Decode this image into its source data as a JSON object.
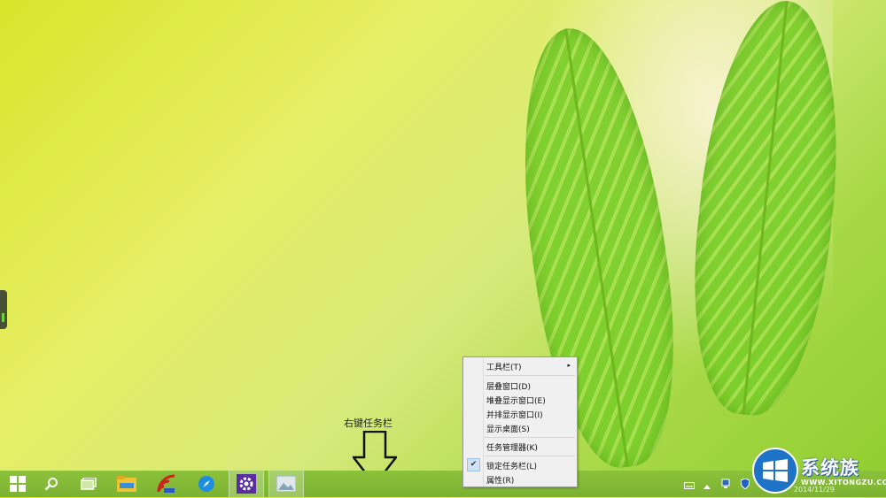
{
  "annotation": {
    "label": "右键任务栏"
  },
  "context_menu": {
    "items": [
      {
        "label": "工具栏(T)",
        "submenu_glyph": "▸",
        "checked": false
      },
      {
        "label": "层叠窗口(D)",
        "checked": false
      },
      {
        "label": "堆叠显示窗口(E)",
        "checked": false
      },
      {
        "label": "并排显示窗口(I)",
        "checked": false
      },
      {
        "label": "显示桌面(S)",
        "checked": false
      },
      {
        "label": "任务管理器(K)",
        "checked": false
      },
      {
        "label": "锁定任务栏(L)",
        "checked": true,
        "check_glyph": "✔"
      },
      {
        "label": "属性(R)",
        "checked": false
      }
    ]
  },
  "taskbar": {
    "pinned_icons": [
      "windows-start-icon",
      "search-icon",
      "task-view-icon",
      "file-explorer-icon",
      "rss-app-icon",
      "compass-browser-icon",
      "settings-gear-icon",
      "photo-viewer-icon"
    ],
    "tray_icons": [
      "keyboard-icon",
      "chevron-up-icon",
      "network-icon",
      "shield-icon"
    ],
    "clock_date": "2014/11/29"
  },
  "watermark": {
    "brand": "系统族",
    "url": "WWW.XITONGZU.COM"
  },
  "colors": {
    "taskbar": "#82b935",
    "menu_bg": "#f0f0f0",
    "accent_blue": "#1e73c8"
  }
}
